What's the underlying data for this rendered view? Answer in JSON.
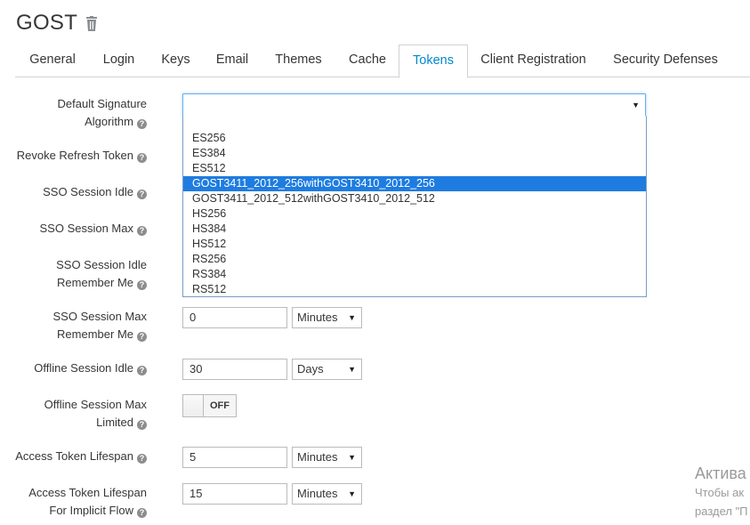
{
  "realm": {
    "title": "GOST",
    "delete_icon": "trash-icon"
  },
  "tabs": [
    {
      "label": "General"
    },
    {
      "label": "Login"
    },
    {
      "label": "Keys"
    },
    {
      "label": "Email"
    },
    {
      "label": "Themes"
    },
    {
      "label": "Cache"
    },
    {
      "label": "Tokens",
      "active": true
    },
    {
      "label": "Client Registration"
    },
    {
      "label": "Security Defenses"
    }
  ],
  "form": {
    "default_signature_algorithm": {
      "label_line1": "Default Signature",
      "label_line2": "Algorithm",
      "value": "",
      "options": [
        "",
        "ES256",
        "ES384",
        "ES512",
        "GOST3411_2012_256withGOST3410_2012_256",
        "GOST3411_2012_512withGOST3410_2012_512",
        "HS256",
        "HS384",
        "HS512",
        "RS256",
        "RS384",
        "RS512"
      ],
      "highlighted": "GOST3411_2012_256withGOST3410_2012_256"
    },
    "revoke_refresh_token": {
      "label": "Revoke Refresh Token"
    },
    "sso_session_idle": {
      "label": "SSO Session Idle"
    },
    "sso_session_max": {
      "label": "SSO Session Max"
    },
    "sso_session_idle_remember_me": {
      "label_line1": "SSO Session Idle",
      "label_line2": "Remember Me"
    },
    "sso_session_max_remember_me": {
      "label_line1": "SSO Session Max",
      "label_line2": "Remember Me",
      "value": "0",
      "unit": "Minutes"
    },
    "offline_session_idle": {
      "label": "Offline Session Idle",
      "value": "30",
      "unit": "Days"
    },
    "offline_session_max_limited": {
      "label_line1": "Offline Session Max",
      "label_line2": "Limited",
      "state": "OFF"
    },
    "access_token_lifespan": {
      "label": "Access Token Lifespan",
      "value": "5",
      "unit": "Minutes"
    },
    "access_token_lifespan_implicit": {
      "label_line1": "Access Token Lifespan",
      "label_line2": "For Implicit Flow",
      "value": "15",
      "unit": "Minutes"
    }
  },
  "help_icon_glyph": "?",
  "caret_glyph": "▼",
  "watermark": {
    "line1": "Актива",
    "line2": "Чтобы ак",
    "line3": "раздел \"П"
  }
}
